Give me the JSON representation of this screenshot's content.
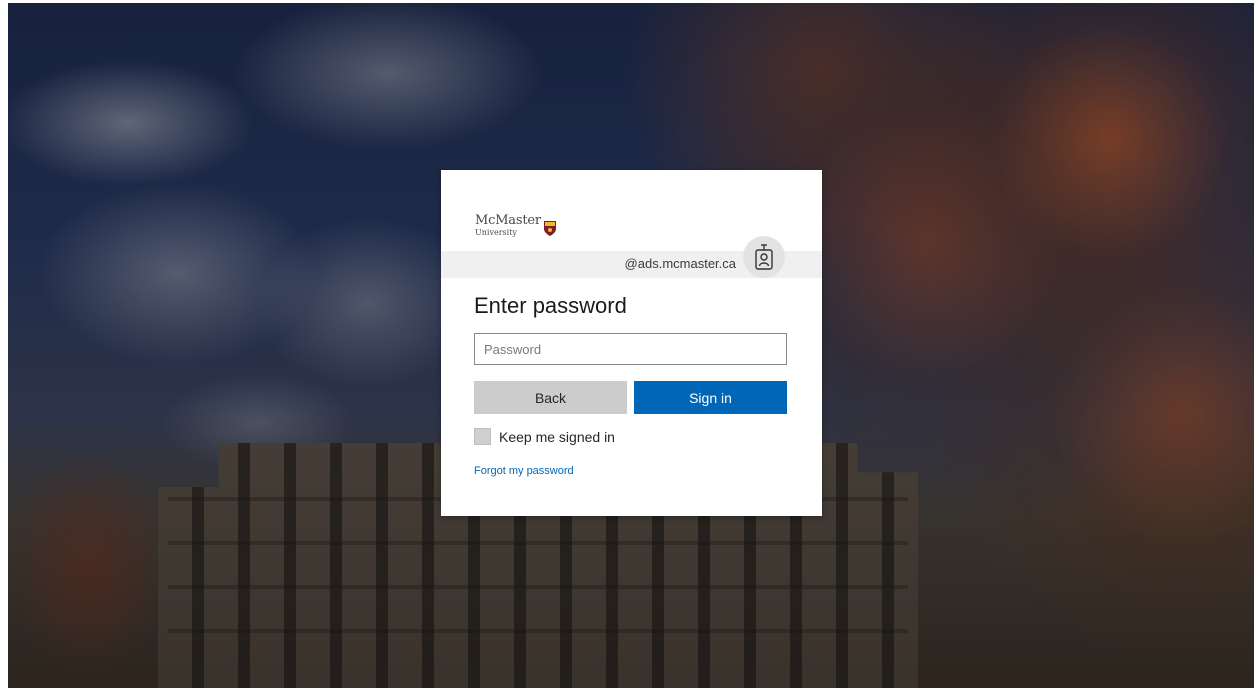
{
  "logo": {
    "name_line1": "McMaster",
    "name_line2": "University"
  },
  "identity": {
    "account": "@ads.mcmaster.ca",
    "icon": "id-badge-icon"
  },
  "form": {
    "title": "Enter password",
    "password_placeholder": "Password",
    "password_value": "",
    "back_label": "Back",
    "signin_label": "Sign in",
    "keep_signed_in_label": "Keep me signed in",
    "keep_signed_in_checked": false,
    "forgot_label": "Forgot my password"
  },
  "colors": {
    "primary_button": "#0067b8",
    "secondary_button": "#cccccc",
    "link": "#0067b8"
  }
}
